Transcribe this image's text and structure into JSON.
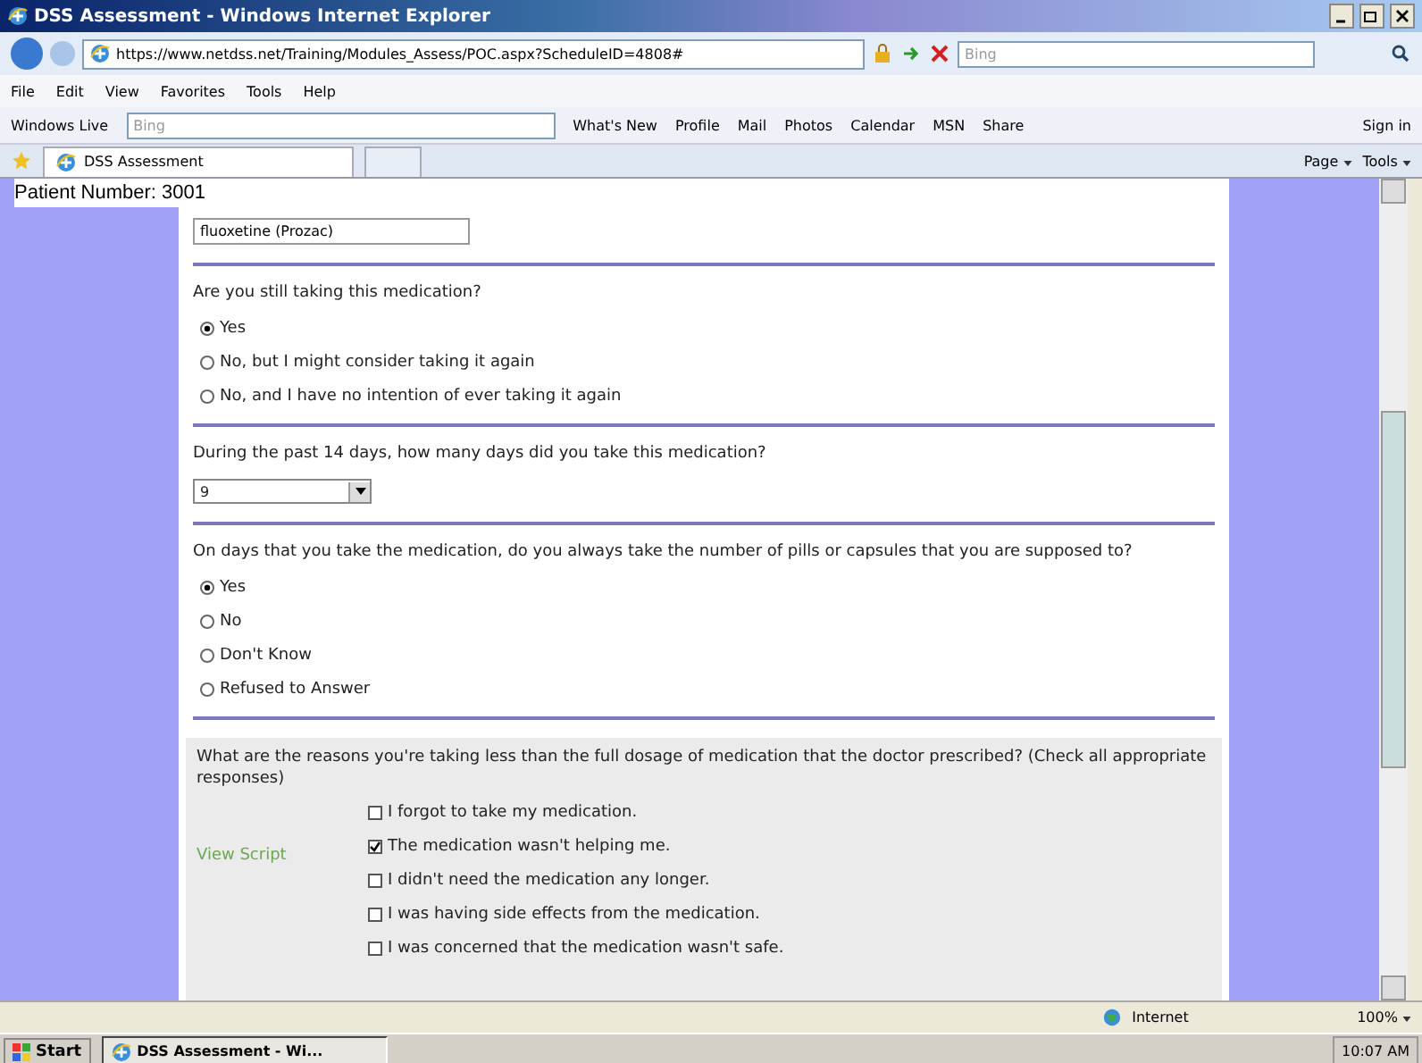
{
  "window": {
    "title": "DSS Assessment - Windows Internet Explorer"
  },
  "address_bar": {
    "url": "https://www.netdss.net/Training/Modules_Assess/POC.aspx?ScheduleID=4808#",
    "search": {
      "placeholder": "Bing"
    }
  },
  "menu": [
    "File",
    "Edit",
    "View",
    "Favorites",
    "Tools",
    "Help"
  ],
  "links_bar": {
    "label": "Windows Live",
    "search": {
      "placeholder": "Bing"
    },
    "links": [
      "What's New",
      "Profile",
      "Mail",
      "Photos",
      "Calendar",
      "MSN",
      "Share"
    ],
    "sign_in": "Sign in"
  },
  "tabs": [
    {
      "label": "DSS Assessment",
      "selected": true
    }
  ],
  "command_bar": [
    "Page",
    "Tools"
  ],
  "page": {
    "patient_label": "Patient Number: 3001",
    "medication": "fluoxetine (Prozac)",
    "questions": [
      {
        "kind": "radio",
        "text": "Are you still taking this medication?",
        "options": [
          {
            "label": "Yes",
            "selected": true
          },
          {
            "label": "No, but I might consider taking it again",
            "selected": false
          },
          {
            "label": "No, and I have no intention of ever taking it again",
            "selected": false
          }
        ]
      },
      {
        "kind": "select",
        "text": "During the past 14 days, how many days did you take this medication?",
        "value": "9"
      },
      {
        "kind": "radio",
        "text": "On days that you take the medication, do you always take the number of pills or capsules that you are supposed to?",
        "options": [
          {
            "label": "Yes",
            "selected": true
          },
          {
            "label": "No",
            "selected": false
          },
          {
            "label": "Don't Know",
            "selected": false
          },
          {
            "label": "Refused to Answer",
            "selected": false
          }
        ]
      },
      {
        "kind": "checkbox",
        "text": "What are the reasons you're taking less than the full dosage of medication that the doctor prescribed? (Check all appropriate responses)",
        "side_link": "View Script",
        "options": [
          {
            "label": "I forgot to take my medication.",
            "checked": false
          },
          {
            "label": "The medication wasn't helping me.",
            "checked": true
          },
          {
            "label": "I didn't need the medication any longer.",
            "checked": false
          },
          {
            "label": "I was having side effects from the medication.",
            "checked": false
          },
          {
            "label": "I was concerned that the medication wasn't safe.",
            "checked": false
          }
        ]
      }
    ]
  },
  "status_bar": {
    "zone": "Internet",
    "zoom": "100%"
  },
  "taskbar": {
    "start": "Start",
    "tasks": [
      {
        "label": "DSS Assessment - Wi...",
        "selected": true
      }
    ],
    "clock": "10:07 AM"
  }
}
